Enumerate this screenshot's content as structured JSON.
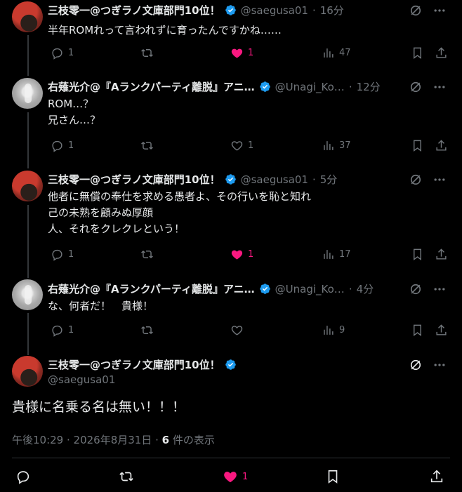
{
  "colors": {
    "background": "#000000",
    "text": "#e7e9ea",
    "muted": "#71767b",
    "like": "#f91880",
    "verified": "#1d9bf0"
  },
  "tweets": [
    {
      "name": "三枝零一@つぎラノ文庫部門10位！",
      "handle": "@saegusa01",
      "time": "16分",
      "lines": [
        "半年ROMれって言われずに育ったんですかね……"
      ],
      "replies": "1",
      "reposts": "",
      "likes": "1",
      "views": "47",
      "liked": true
    },
    {
      "name": "右薙光介@『Aランクパーティ離脱』アニ…",
      "handle": "@Unagi_Ko…",
      "time": "12分",
      "lines": [
        "ROM…？",
        "兄さん…？"
      ],
      "replies": "1",
      "reposts": "",
      "likes": "1",
      "views": "37",
      "liked": false
    },
    {
      "name": "三枝零一@つぎラノ文庫部門10位！",
      "handle": "@saegusa01",
      "time": "5分",
      "lines": [
        "他者に無償の奉仕を求める愚者よ、その行いを恥と知れ",
        "己の未熟を顧みぬ厚顔",
        "人、それをクレクレという！"
      ],
      "replies": "1",
      "reposts": "",
      "likes": "1",
      "views": "17",
      "liked": true
    },
    {
      "name": "右薙光介@『Aランクパーティ離脱』アニ…",
      "handle": "@Unagi_Ko…",
      "time": "4分",
      "lines": [
        "な、何者だ！　貴様！"
      ],
      "replies": "1",
      "reposts": "",
      "likes": "",
      "views": "9",
      "liked": false
    }
  ],
  "main": {
    "name": "三枝零一@つぎラノ文庫部門10位！",
    "handle": "@saegusa01",
    "text": "貴様に名乗る名は無い！！！",
    "timestamp": "午後10:29 · 2026年8月31日 · ",
    "views_count": "6",
    "views_label": " 件の表示",
    "likes": "1"
  },
  "separator": "·",
  "icons": [
    "reply-icon",
    "repost-icon",
    "like-icon",
    "views-icon",
    "bookmark-icon",
    "share-icon",
    "grok-icon",
    "more-icon",
    "verified-icon"
  ]
}
